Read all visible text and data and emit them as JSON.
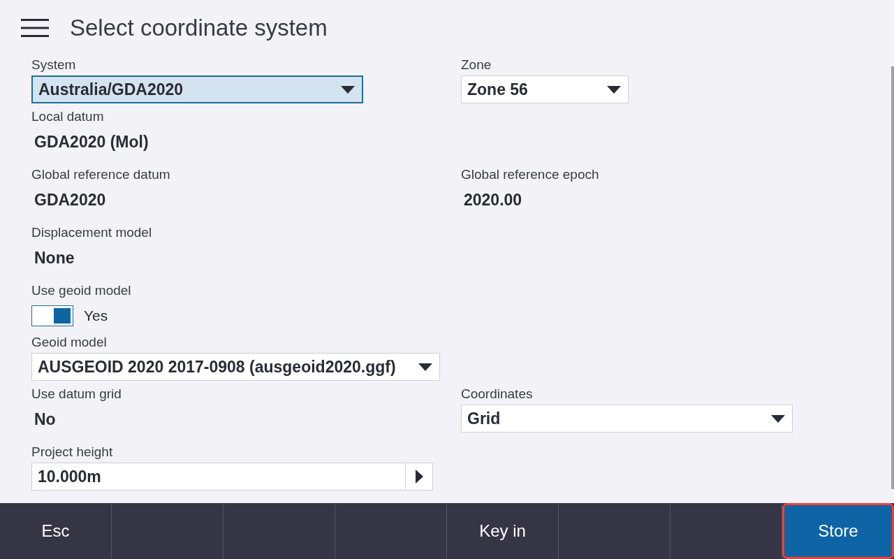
{
  "header": {
    "title": "Select coordinate system"
  },
  "rows": [
    {
      "left": {
        "kind": "dropdown",
        "label": "System",
        "value": "Australia/GDA2020",
        "focused": true
      },
      "right": {
        "kind": "dropdown",
        "label": "Zone",
        "value": "Zone 56",
        "focused": false
      }
    },
    {
      "left": {
        "kind": "value",
        "label": "Local datum",
        "value": "GDA2020 (Mol)"
      }
    },
    {
      "left": {
        "kind": "value",
        "label": "Global reference datum",
        "value": "GDA2020"
      },
      "right": {
        "kind": "value",
        "label": "Global reference epoch",
        "value": "2020.00"
      }
    },
    {
      "left": {
        "kind": "value",
        "label": "Displacement model",
        "value": "None"
      }
    },
    {
      "left": {
        "kind": "toggle",
        "label": "Use geoid model",
        "value": "Yes",
        "on": true
      }
    },
    {
      "left": {
        "kind": "dropdown",
        "label": "Geoid model",
        "value": "AUSGEOID 2020 2017-0908 (ausgeoid2020.ggf)",
        "focused": false
      }
    },
    {
      "left": {
        "kind": "value",
        "label": "Use datum grid",
        "value": "No"
      },
      "right": {
        "kind": "dropdown",
        "label": "Coordinates",
        "value": "Grid",
        "focused": false
      }
    },
    {
      "left": {
        "kind": "input",
        "label": "Project height",
        "value": "10.000m"
      }
    }
  ],
  "softkeys": [
    {
      "kind": "text",
      "label": "Esc"
    },
    {
      "kind": "empty"
    },
    {
      "kind": "empty"
    },
    {
      "kind": "empty"
    },
    {
      "kind": "text",
      "label": "Key in"
    },
    {
      "kind": "empty"
    },
    {
      "kind": "empty"
    },
    {
      "kind": "primary",
      "label": "Store",
      "highlighted": true
    }
  ]
}
